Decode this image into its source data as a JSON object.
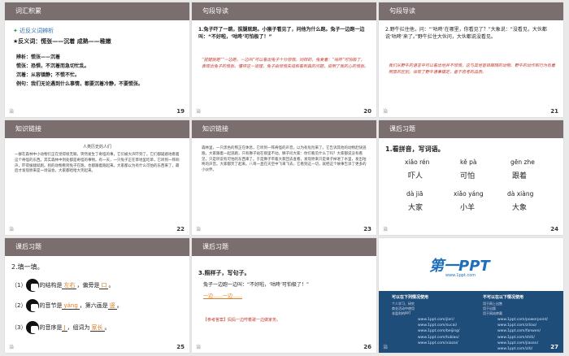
{
  "slides": [
    {
      "title": "词汇积累",
      "number": "19",
      "footer": "治",
      "sub": "近反义词辨析",
      "line1": "★反义词：慌张——沉着  成熟——稚嫩",
      "body": [
        "辨析：慌张——沉着",
        "慌张：恐惧，不沉着而急切忙乱。",
        "沉着：从容镇静；不慌不忙。",
        "例句：我们无论遇到什么事情，都要沉着冷静，不要慌张。"
      ]
    },
    {
      "title": "句段导读",
      "number": "20",
      "footer": "治",
      "q": "1.兔子吓了一跳，拔腿就跑。小猴子看见了，问他为什么跑。兔子一边跑一边叫：“不好啦，‘咕咚’可怕极了！”",
      "a": "“拔腿就跑”“一边跑，一边叫”可以看出兔子十分惊慌。同样的，兔爱着：“咕咚”可怕极了，表现出兔子的慌张。懂得这一道理，兔子由惊慌失措和看到真的问题，说明了我的心的慌张。"
    },
    {
      "title": "句段导读",
      "number": "21",
      "footer": "治",
      "q": "2.野牛拦住他，问：“‘咕咚’在哪里，你看见了？”大象说：“没看见，大伙都说‘咕咚’来了。”野牛拦住大伙问，大伙都说没看见。",
      "a": "我们从野牛的语言中可以看出他并不惊慌，这与其他盲目跟随的动物、野牛的动作和行为有着明显的区别。体现了野牛遇事镇定，善于思考的品质。"
    },
    {
      "title": "知识链接",
      "number": "22",
      "footer": "治",
      "doc_title": "人类历史的人们",
      "doc": "一群在森林中小动物们正在觉得很无聊。突然发生了奇怪的事，它们被大声吓到了。它们都疑惑地看着这个奇怪的东西。其实森林中到处都是奇怪的事物。有一天，一只兔子正在草地里吃草，它听到一阵响声，吓得拔腿就跑。别的动物看到兔子在跑，也都跟着跑起来。大家都以为有什么可怕的东西来了，最后才发现原来是一场误会，大家都哈哈大笑起来。"
    },
    {
      "title": "知识链接",
      "number": "23",
      "footer": "治",
      "doc": "森林里，一只黑色的熊正在休息，它听到一阵奇怪的声音，以为有危险来了。它告诉其他的动物赶快逃跑。大家跟着一起逃跑，只有狮子站在那里不动。狮子问大家：你们看见什么了吗？大家都说没有看见，只是听说有可怕的东西来了。于是狮子带着大家回去查看，发现原来只是果子掉进了水里，发出咕咚的声音。大家都笑了起来。八哥一直在天空中飞来飞去，它看到这一切，就把这个故事告诉了更多的小伙伴。"
    },
    {
      "title": "课后习题",
      "number": "24",
      "footer": "治",
      "heading": "1.看拼音，写词语。",
      "pinyin": [
        "xiǎo rén",
        "kě pà",
        "gēn zhe",
        "dà jiā",
        "xiǎo yáng",
        "dà xiàng"
      ],
      "words": [
        "吓人",
        "可怕",
        "跟着",
        "大家",
        "小羊",
        "大象"
      ]
    },
    {
      "title": "课后习题",
      "number": "25",
      "footer": "治",
      "heading": "2.填一填。",
      "r1": [
        "（1）",
        "的结构是",
        "左右",
        "，偏旁是",
        "口",
        "。"
      ],
      "r2": [
        "（2）",
        "的音节是",
        "yáng",
        "，第六画是",
        "竖",
        "。"
      ],
      "r3": [
        "（3）",
        "的音序是",
        "J",
        "，组词为",
        "家长",
        "。"
      ]
    },
    {
      "title": "课后习题",
      "number": "26",
      "footer": "治",
      "heading": "3.照样子，写句子。",
      "example": "兔子一边跑一边叫：“不好啦，‘咕咚’可怕极了！”",
      "blank": "一边……一边……",
      "ref": "【参考答案】妈妈一边哼着歌一边做家务。"
    },
    {
      "number": "27",
      "footer": "治",
      "brand": "第一PPT",
      "url": "www.1ppt.com",
      "col1_title": "可以在下列情况使用",
      "col1": [
        "个人学习、研究",
        "商业活动中使用",
        "非盈利的PPT"
      ],
      "col2_title": "不可以在以下情况使用",
      "col2": [
        "用于网上出售",
        "用于出版",
        "用于网站转载"
      ],
      "links": [
        "www.1ppt.com/jieri/",
        "www.1ppt.com/sucai/",
        "www.1ppt.com/beijing/",
        "www.1ppt.com/tubiao/",
        "www.1ppt.com/xiazai/",
        "www.1ppt.com/powerpoint/",
        "www.1ppt.com/ziliao/",
        "www.1ppt.com/fanwen/",
        "www.1ppt.com/shiti/",
        "www.1ppt.com/jiaoan/",
        "www.1ppt.com/ziti/"
      ]
    }
  ]
}
